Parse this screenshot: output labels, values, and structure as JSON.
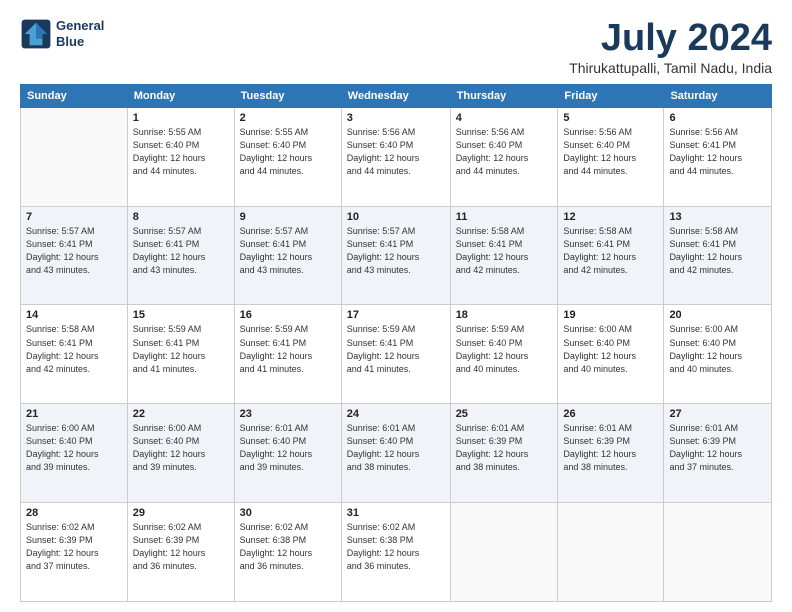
{
  "logo": {
    "line1": "General",
    "line2": "Blue"
  },
  "title": "July 2024",
  "subtitle": "Thirukattupalli, Tamil Nadu, India",
  "weekdays": [
    "Sunday",
    "Monday",
    "Tuesday",
    "Wednesday",
    "Thursday",
    "Friday",
    "Saturday"
  ],
  "weeks": [
    [
      {
        "day": "",
        "info": ""
      },
      {
        "day": "1",
        "info": "Sunrise: 5:55 AM\nSunset: 6:40 PM\nDaylight: 12 hours\nand 44 minutes."
      },
      {
        "day": "2",
        "info": "Sunrise: 5:55 AM\nSunset: 6:40 PM\nDaylight: 12 hours\nand 44 minutes."
      },
      {
        "day": "3",
        "info": "Sunrise: 5:56 AM\nSunset: 6:40 PM\nDaylight: 12 hours\nand 44 minutes."
      },
      {
        "day": "4",
        "info": "Sunrise: 5:56 AM\nSunset: 6:40 PM\nDaylight: 12 hours\nand 44 minutes."
      },
      {
        "day": "5",
        "info": "Sunrise: 5:56 AM\nSunset: 6:40 PM\nDaylight: 12 hours\nand 44 minutes."
      },
      {
        "day": "6",
        "info": "Sunrise: 5:56 AM\nSunset: 6:41 PM\nDaylight: 12 hours\nand 44 minutes."
      }
    ],
    [
      {
        "day": "7",
        "info": "Sunrise: 5:57 AM\nSunset: 6:41 PM\nDaylight: 12 hours\nand 43 minutes."
      },
      {
        "day": "8",
        "info": "Sunrise: 5:57 AM\nSunset: 6:41 PM\nDaylight: 12 hours\nand 43 minutes."
      },
      {
        "day": "9",
        "info": "Sunrise: 5:57 AM\nSunset: 6:41 PM\nDaylight: 12 hours\nand 43 minutes."
      },
      {
        "day": "10",
        "info": "Sunrise: 5:57 AM\nSunset: 6:41 PM\nDaylight: 12 hours\nand 43 minutes."
      },
      {
        "day": "11",
        "info": "Sunrise: 5:58 AM\nSunset: 6:41 PM\nDaylight: 12 hours\nand 42 minutes."
      },
      {
        "day": "12",
        "info": "Sunrise: 5:58 AM\nSunset: 6:41 PM\nDaylight: 12 hours\nand 42 minutes."
      },
      {
        "day": "13",
        "info": "Sunrise: 5:58 AM\nSunset: 6:41 PM\nDaylight: 12 hours\nand 42 minutes."
      }
    ],
    [
      {
        "day": "14",
        "info": "Sunrise: 5:58 AM\nSunset: 6:41 PM\nDaylight: 12 hours\nand 42 minutes."
      },
      {
        "day": "15",
        "info": "Sunrise: 5:59 AM\nSunset: 6:41 PM\nDaylight: 12 hours\nand 41 minutes."
      },
      {
        "day": "16",
        "info": "Sunrise: 5:59 AM\nSunset: 6:41 PM\nDaylight: 12 hours\nand 41 minutes."
      },
      {
        "day": "17",
        "info": "Sunrise: 5:59 AM\nSunset: 6:41 PM\nDaylight: 12 hours\nand 41 minutes."
      },
      {
        "day": "18",
        "info": "Sunrise: 5:59 AM\nSunset: 6:40 PM\nDaylight: 12 hours\nand 40 minutes."
      },
      {
        "day": "19",
        "info": "Sunrise: 6:00 AM\nSunset: 6:40 PM\nDaylight: 12 hours\nand 40 minutes."
      },
      {
        "day": "20",
        "info": "Sunrise: 6:00 AM\nSunset: 6:40 PM\nDaylight: 12 hours\nand 40 minutes."
      }
    ],
    [
      {
        "day": "21",
        "info": "Sunrise: 6:00 AM\nSunset: 6:40 PM\nDaylight: 12 hours\nand 39 minutes."
      },
      {
        "day": "22",
        "info": "Sunrise: 6:00 AM\nSunset: 6:40 PM\nDaylight: 12 hours\nand 39 minutes."
      },
      {
        "day": "23",
        "info": "Sunrise: 6:01 AM\nSunset: 6:40 PM\nDaylight: 12 hours\nand 39 minutes."
      },
      {
        "day": "24",
        "info": "Sunrise: 6:01 AM\nSunset: 6:40 PM\nDaylight: 12 hours\nand 38 minutes."
      },
      {
        "day": "25",
        "info": "Sunrise: 6:01 AM\nSunset: 6:39 PM\nDaylight: 12 hours\nand 38 minutes."
      },
      {
        "day": "26",
        "info": "Sunrise: 6:01 AM\nSunset: 6:39 PM\nDaylight: 12 hours\nand 38 minutes."
      },
      {
        "day": "27",
        "info": "Sunrise: 6:01 AM\nSunset: 6:39 PM\nDaylight: 12 hours\nand 37 minutes."
      }
    ],
    [
      {
        "day": "28",
        "info": "Sunrise: 6:02 AM\nSunset: 6:39 PM\nDaylight: 12 hours\nand 37 minutes."
      },
      {
        "day": "29",
        "info": "Sunrise: 6:02 AM\nSunset: 6:39 PM\nDaylight: 12 hours\nand 36 minutes."
      },
      {
        "day": "30",
        "info": "Sunrise: 6:02 AM\nSunset: 6:38 PM\nDaylight: 12 hours\nand 36 minutes."
      },
      {
        "day": "31",
        "info": "Sunrise: 6:02 AM\nSunset: 6:38 PM\nDaylight: 12 hours\nand 36 minutes."
      },
      {
        "day": "",
        "info": ""
      },
      {
        "day": "",
        "info": ""
      },
      {
        "day": "",
        "info": ""
      }
    ]
  ]
}
